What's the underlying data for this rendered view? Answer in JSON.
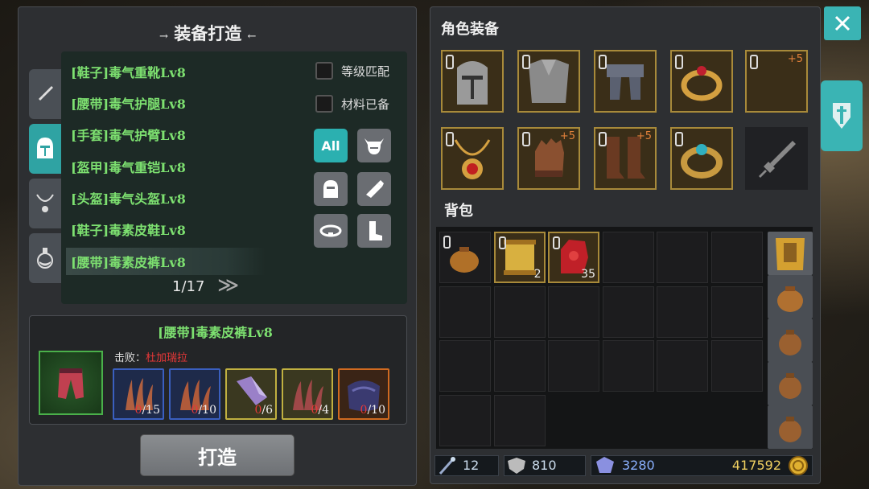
{
  "left_panel": {
    "title": "装备打造",
    "title_deco_left": "→",
    "title_deco_right": "←"
  },
  "tabs": [
    {
      "icon": "sword-icon"
    },
    {
      "icon": "helmet-icon"
    },
    {
      "icon": "necklace-icon"
    },
    {
      "icon": "potion-icon"
    }
  ],
  "recipes": [
    "[鞋子]毒气重靴Lv8",
    "[腰带]毒气护腿Lv8",
    "[手套]毒气护臂Lv8",
    "[盔甲]毒气重铠Lv8",
    "[头盔]毒气头盔Lv8",
    "[鞋子]毒素皮鞋Lv8",
    "[腰带]毒素皮裤Lv8"
  ],
  "filters": {
    "level_match": "等级匹配",
    "materials_ready": "材料已备",
    "all_label": "All"
  },
  "pagination": {
    "page": "1/17",
    "next": "≫"
  },
  "detail": {
    "name": "[腰带]毒素皮裤Lv8",
    "defeat_label": "击败：",
    "defeat_target": "杜加瑞拉",
    "materials": [
      {
        "have": "0",
        "need": "/15",
        "border": "#3a5fbf"
      },
      {
        "have": "0",
        "need": "/10",
        "border": "#3a5fbf"
      },
      {
        "have": "0",
        "need": "/6",
        "border": "#c0b040"
      },
      {
        "have": "0",
        "need": "/4",
        "border": "#c0b040"
      },
      {
        "have": "0",
        "need": "/10",
        "border": "#d06a20"
      }
    ]
  },
  "craft_button": "打造",
  "right_panel": {
    "equip_title": "角色装备",
    "bag_title": "背包",
    "equip_plus": [
      "+5",
      "+5",
      "+5"
    ],
    "bag_counts": [
      "2",
      "35"
    ]
  },
  "currency": {
    "attack": "12",
    "defense": "810",
    "gem": "3280",
    "gold": "417592"
  },
  "colors": {
    "accent": "#2fa3a3",
    "recipe_text": "#7de070",
    "gold_border": "#a88a3a"
  }
}
